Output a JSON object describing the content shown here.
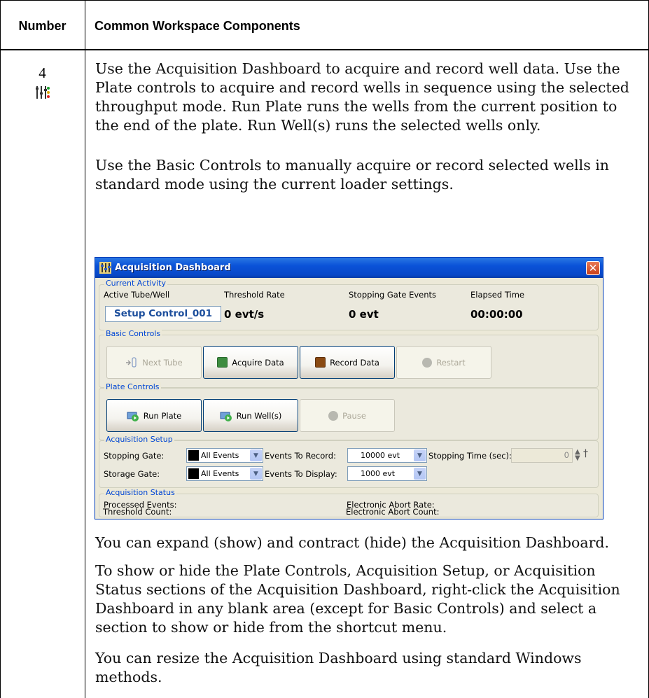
{
  "table": {
    "header_number": "Number",
    "header_components": "Common Workspace Components",
    "row_number": "4",
    "row_icon": "acquisition-dashboard-icon"
  },
  "paragraphs": {
    "p1": "Use the Acquisition Dashboard to acquire and record well data. Use the Plate controls to acquire and record wells in sequence using the selected throughput mode. Run Plate runs the wells from the current position to the end of the plate. Run Well(s) runs the selected wells only.",
    "p2": "Use the Basic Controls to manually acquire or record selected wells in standard mode using the current loader settings.",
    "p3": "You can expand (show) and contract (hide) the Acquisition Dashboard.",
    "p4": "To show or hide the Plate Controls, Acquisition Setup, or Acquisition Status sections of the Acquisition Dashboard, right-click the Acquisition Dashboard in any blank area (except for Basic Controls) and select a section to show or hide from the shortcut menu.",
    "p5": "You can resize the Acquisition Dashboard using standard Windows methods."
  },
  "dashboard": {
    "title": "Acquisition Dashboard",
    "close": "✕",
    "current_activity": {
      "label": "Current Activity",
      "active_tube_label": "Active Tube/Well",
      "active_tube_value": "Setup Control_001",
      "threshold_rate_label": "Threshold Rate",
      "threshold_rate_value": "0 evt/s",
      "stopping_gate_events_label": "Stopping Gate Events",
      "stopping_gate_events_value": "0 evt",
      "elapsed_time_label": "Elapsed Time",
      "elapsed_time_value": "00:00:00"
    },
    "basic_controls": {
      "label": "Basic Controls",
      "next_tube": "Next Tube",
      "acquire_data": "Acquire Data",
      "record_data": "Record Data",
      "restart": "Restart"
    },
    "plate_controls": {
      "label": "Plate Controls",
      "run_plate": "Run Plate",
      "run_wells": "Run Well(s)",
      "pause": "Pause"
    },
    "acquisition_setup": {
      "label": "Acquisition Setup",
      "stopping_gate_label": "Stopping Gate:",
      "stopping_gate_value": "All Events",
      "events_to_record_label": "Events To Record:",
      "events_to_record_value": "10000 evt",
      "stopping_time_label": "Stopping Time (sec):",
      "stopping_time_value": "0",
      "storage_gate_label": "Storage Gate:",
      "storage_gate_value": "All Events",
      "events_to_display_label": "Events To Display:",
      "events_to_display_value": "1000 evt"
    },
    "acquisition_status": {
      "label": "Acquisition Status",
      "processed_events_label": "Processed Events:",
      "threshold_count_label": "Threshold Count:",
      "electronic_abort_rate_label": "Electronic Abort Rate:",
      "electronic_abort_count_label": "Electronic Abort Count:"
    },
    "colors": {
      "title_bar": "#0a52d8",
      "acquire_square": "#3d8c40",
      "record_square": "#8a4a12"
    }
  }
}
